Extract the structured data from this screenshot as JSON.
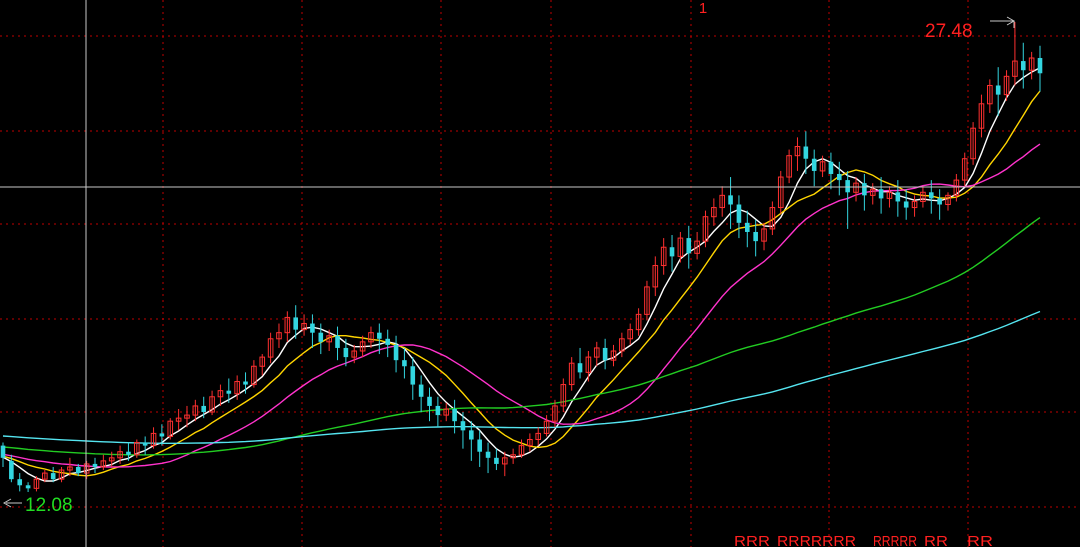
{
  "chart_data": {
    "type": "candlestick",
    "title": "",
    "top_marker": "1",
    "max_label": "27.48",
    "min_label": "12.08",
    "bottom_signals": [
      "RRR",
      "RRRRRRR",
      "RRRRR",
      "RR",
      "RR"
    ],
    "colors": {
      "background": "#000000",
      "grid": "#c00000",
      "up": "#ff3030",
      "down": "#33d6e0",
      "max_label": "#ff2020",
      "min_label": "#22dd22",
      "crosshair": "#c8c8c8",
      "signal": "#ff2020"
    },
    "y_range": [
      11.4,
      29.5
    ],
    "price_at_rows": [
      {
        "row": "a",
        "price": 12.08
      },
      {
        "row": "b",
        "price": 27.48
      }
    ],
    "candles": [
      [
        13.6,
        13.7,
        13.2,
        12.9
      ],
      [
        13.1,
        13.3,
        12.5,
        12.4
      ],
      [
        12.5,
        12.7,
        12.3,
        12.1
      ],
      [
        12.3,
        12.4,
        12.2,
        12.08
      ],
      [
        12.2,
        12.6,
        12.5,
        12.1
      ],
      [
        12.5,
        12.8,
        12.7,
        12.4
      ],
      [
        12.7,
        12.9,
        12.5,
        12.4
      ],
      [
        12.5,
        12.9,
        12.8,
        12.4
      ],
      [
        12.8,
        13.2,
        12.9,
        12.6
      ],
      [
        12.9,
        13.0,
        12.7,
        12.6
      ],
      [
        12.7,
        13.1,
        13.0,
        12.5
      ],
      [
        13.0,
        13.2,
        12.9,
        12.7
      ],
      [
        12.9,
        13.3,
        13.1,
        12.8
      ],
      [
        13.1,
        13.4,
        13.2,
        12.9
      ],
      [
        13.2,
        13.6,
        13.4,
        13.0
      ],
      [
        13.4,
        13.7,
        13.3,
        13.1
      ],
      [
        13.3,
        13.8,
        13.7,
        13.2
      ],
      [
        13.7,
        13.9,
        13.6,
        13.3
      ],
      [
        13.6,
        14.2,
        14.0,
        13.5
      ],
      [
        14.0,
        14.3,
        13.9,
        13.6
      ],
      [
        13.9,
        14.5,
        14.4,
        13.8
      ],
      [
        14.4,
        14.8,
        14.5,
        14.1
      ],
      [
        14.5,
        14.9,
        14.6,
        14.2
      ],
      [
        14.6,
        15.1,
        14.9,
        14.4
      ],
      [
        14.9,
        15.2,
        14.7,
        14.5
      ],
      [
        14.7,
        15.4,
        15.2,
        14.6
      ],
      [
        15.2,
        15.6,
        15.4,
        14.9
      ],
      [
        15.4,
        15.8,
        15.3,
        15.0
      ],
      [
        15.3,
        15.9,
        15.7,
        15.1
      ],
      [
        15.7,
        16.0,
        15.6,
        15.3
      ],
      [
        15.6,
        16.4,
        16.2,
        15.5
      ],
      [
        16.2,
        16.6,
        16.5,
        15.9
      ],
      [
        16.5,
        17.3,
        17.1,
        16.3
      ],
      [
        17.1,
        17.6,
        17.3,
        16.8
      ],
      [
        17.3,
        18.0,
        17.8,
        17.0
      ],
      [
        17.8,
        18.2,
        17.4,
        17.1
      ],
      [
        17.4,
        17.9,
        17.6,
        17.2
      ],
      [
        17.6,
        17.9,
        17.3,
        16.8
      ],
      [
        17.3,
        17.6,
        17.0,
        16.6
      ],
      [
        17.0,
        17.4,
        17.2,
        16.7
      ],
      [
        17.2,
        17.5,
        16.8,
        16.4
      ],
      [
        16.8,
        17.1,
        16.5,
        16.2
      ],
      [
        16.5,
        16.9,
        16.7,
        16.3
      ],
      [
        16.7,
        17.2,
        17.0,
        16.5
      ],
      [
        17.0,
        17.5,
        17.3,
        16.8
      ],
      [
        17.3,
        17.6,
        17.1,
        16.6
      ],
      [
        17.1,
        17.4,
        16.9,
        16.5
      ],
      [
        16.9,
        17.2,
        16.4,
        16.0
      ],
      [
        16.4,
        16.8,
        16.2,
        15.8
      ],
      [
        16.2,
        16.5,
        15.6,
        15.1
      ],
      [
        15.6,
        15.9,
        15.2,
        14.7
      ],
      [
        15.2,
        15.5,
        14.9,
        14.4
      ],
      [
        14.9,
        15.2,
        14.6,
        14.2
      ],
      [
        14.6,
        15.0,
        14.8,
        14.4
      ],
      [
        14.8,
        15.1,
        14.4,
        14.0
      ],
      [
        14.4,
        14.7,
        14.1,
        13.5
      ],
      [
        14.1,
        14.4,
        13.8,
        13.1
      ],
      [
        13.8,
        14.1,
        13.4,
        12.9
      ],
      [
        13.4,
        13.7,
        13.2,
        12.7
      ],
      [
        13.2,
        13.5,
        13.0,
        12.8
      ],
      [
        13.0,
        13.4,
        13.2,
        12.6
      ],
      [
        13.2,
        13.5,
        13.3,
        13.0
      ],
      [
        13.3,
        13.8,
        13.6,
        13.2
      ],
      [
        13.6,
        14.0,
        13.8,
        13.4
      ],
      [
        13.8,
        14.2,
        14.0,
        13.6
      ],
      [
        14.0,
        14.6,
        14.4,
        13.9
      ],
      [
        14.4,
        15.1,
        14.9,
        14.2
      ],
      [
        14.9,
        15.8,
        15.6,
        14.7
      ],
      [
        15.6,
        16.5,
        16.3,
        15.4
      ],
      [
        16.3,
        16.8,
        16.0,
        15.8
      ],
      [
        16.0,
        16.7,
        16.5,
        15.7
      ],
      [
        16.5,
        17.0,
        16.8,
        16.2
      ],
      [
        16.8,
        17.1,
        16.4,
        16.1
      ],
      [
        16.4,
        16.9,
        16.7,
        16.2
      ],
      [
        16.7,
        17.3,
        17.1,
        16.5
      ],
      [
        17.1,
        17.6,
        17.4,
        16.9
      ],
      [
        17.4,
        18.1,
        17.9,
        17.2
      ],
      [
        17.9,
        19.0,
        18.8,
        17.7
      ],
      [
        18.8,
        19.8,
        19.5,
        18.5
      ],
      [
        19.5,
        20.4,
        20.1,
        19.2
      ],
      [
        20.1,
        20.5,
        19.8,
        19.3
      ],
      [
        19.8,
        20.6,
        20.4,
        19.6
      ],
      [
        20.4,
        20.8,
        19.9,
        19.4
      ],
      [
        19.9,
        20.6,
        20.3,
        19.7
      ],
      [
        20.3,
        21.3,
        21.1,
        20.1
      ],
      [
        21.1,
        21.7,
        21.4,
        20.8
      ],
      [
        21.4,
        22.1,
        21.8,
        21.1
      ],
      [
        21.8,
        22.4,
        21.5,
        20.7
      ],
      [
        21.5,
        21.8,
        20.9,
        20.4
      ],
      [
        20.9,
        21.3,
        20.6,
        20.1
      ],
      [
        20.6,
        21.0,
        20.3,
        19.8
      ],
      [
        20.3,
        20.9,
        20.7,
        20.0
      ],
      [
        20.7,
        21.6,
        21.4,
        20.5
      ],
      [
        21.4,
        22.6,
        22.4,
        21.2
      ],
      [
        22.4,
        23.3,
        23.1,
        22.2
      ],
      [
        23.1,
        23.7,
        23.4,
        22.6
      ],
      [
        23.4,
        23.9,
        23.0,
        22.5
      ],
      [
        23.0,
        23.3,
        22.6,
        22.1
      ],
      [
        22.6,
        23.1,
        22.9,
        22.4
      ],
      [
        22.9,
        23.2,
        22.5,
        22.0
      ],
      [
        22.5,
        22.9,
        22.3,
        21.8
      ],
      [
        22.3,
        22.6,
        21.9,
        20.7
      ],
      [
        21.9,
        22.4,
        22.2,
        21.6
      ],
      [
        22.2,
        22.5,
        21.8,
        21.3
      ],
      [
        21.8,
        22.2,
        22.0,
        21.5
      ],
      [
        22.0,
        22.4,
        21.7,
        21.2
      ],
      [
        21.7,
        22.1,
        21.9,
        21.4
      ],
      [
        21.9,
        22.3,
        21.6,
        21.1
      ],
      [
        21.6,
        22.0,
        21.4,
        21.0
      ],
      [
        21.4,
        21.8,
        21.6,
        21.1
      ],
      [
        21.6,
        22.1,
        21.9,
        21.4
      ],
      [
        21.9,
        22.3,
        21.7,
        21.2
      ],
      [
        21.7,
        22.0,
        21.5,
        21.0
      ],
      [
        21.5,
        21.9,
        21.8,
        21.3
      ],
      [
        21.8,
        22.5,
        22.3,
        21.6
      ],
      [
        22.3,
        23.2,
        23.0,
        22.1
      ],
      [
        23.0,
        24.2,
        24.0,
        22.8
      ],
      [
        24.0,
        25.1,
        24.8,
        23.7
      ],
      [
        24.8,
        25.6,
        25.4,
        24.5
      ],
      [
        25.4,
        26.0,
        25.1,
        24.4
      ],
      [
        25.1,
        25.9,
        25.7,
        24.9
      ],
      [
        25.7,
        27.48,
        26.2,
        25.4
      ],
      [
        26.2,
        26.8,
        25.9,
        25.3
      ],
      [
        25.9,
        26.5,
        26.3,
        25.6
      ],
      [
        26.3,
        26.7,
        25.8,
        25.2
      ]
    ],
    "moving_averages": [
      {
        "period": 5,
        "color": "#ffffff"
      },
      {
        "period": 10,
        "color": "#ffd500"
      },
      {
        "period": 20,
        "color": "#ff33cc"
      },
      {
        "period": 60,
        "color": "#22cc22"
      },
      {
        "period": 120,
        "color": "#55e5f0"
      }
    ]
  }
}
